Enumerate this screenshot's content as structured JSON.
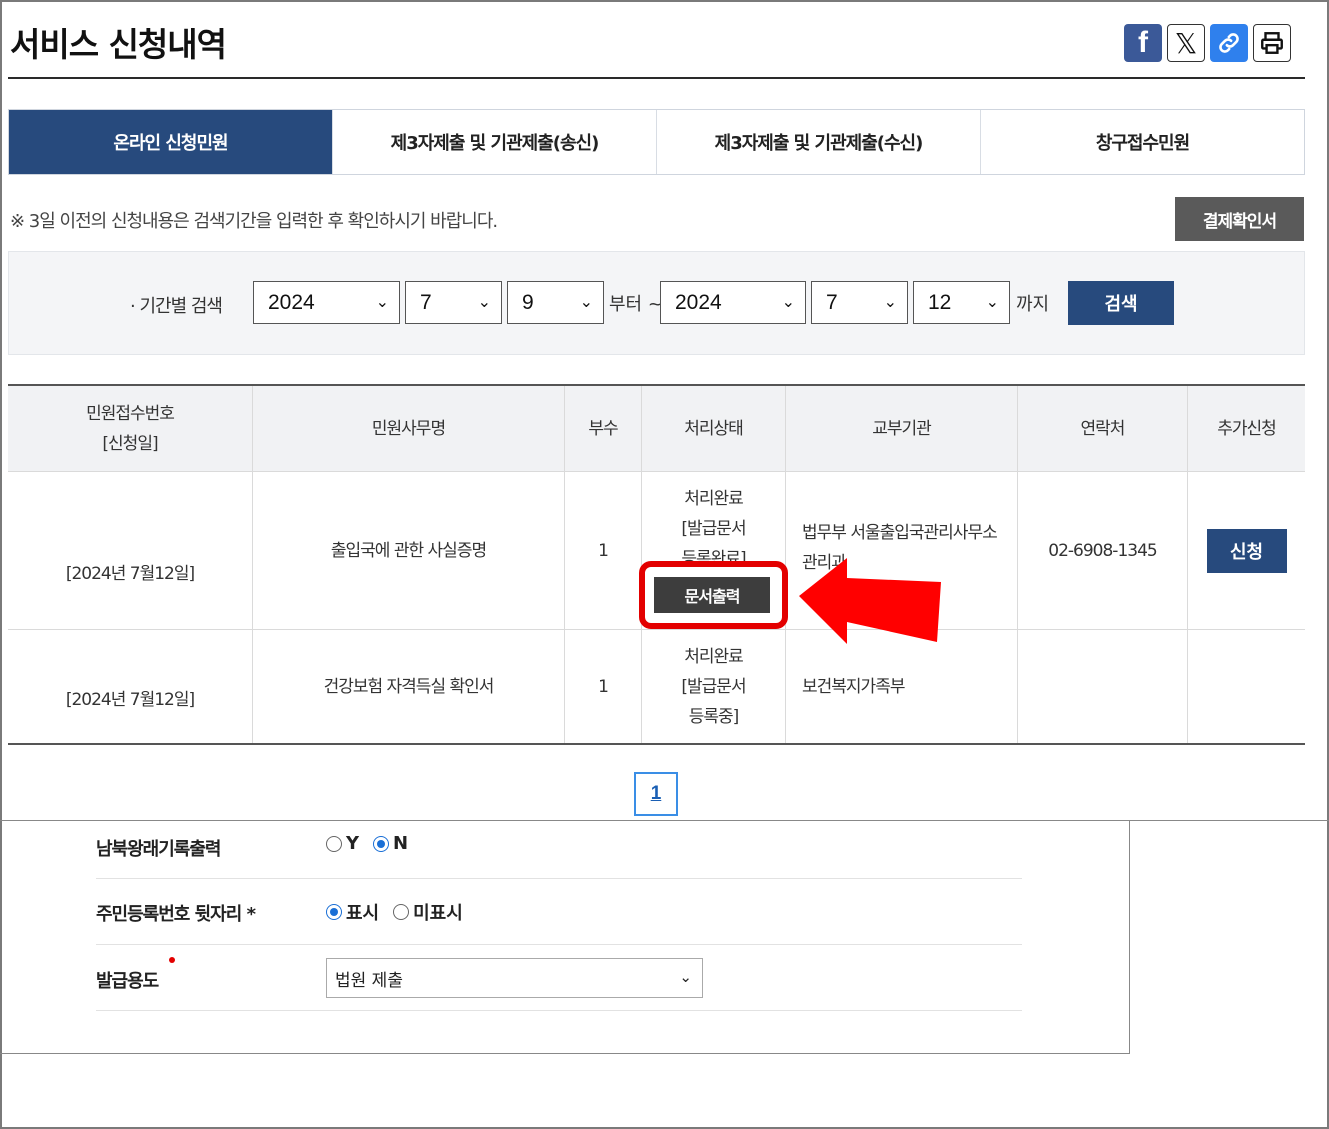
{
  "page": {
    "title": "서비스 신청내역"
  },
  "share": {
    "facebook": "f",
    "x": "𝕏"
  },
  "tabs": [
    {
      "label": "온라인 신청민원",
      "active": true
    },
    {
      "label": "제3자제출 및 기관제출(송신)",
      "active": false
    },
    {
      "label": "제3자제출 및 기관제출(수신)",
      "active": false
    },
    {
      "label": "창구접수민원",
      "active": false
    }
  ],
  "notice": "※ 3일 이전의 신청내용은 검색기간을 입력한 후 확인하시기 바랍니다.",
  "receipt_button": "결제확인서",
  "search": {
    "label": "· 기간별 검색",
    "from": {
      "year": "2024",
      "month": "7",
      "day": "9"
    },
    "from_text": "부터 ~",
    "to": {
      "year": "2024",
      "month": "7",
      "day": "12"
    },
    "to_text": "까지",
    "button": "검색"
  },
  "table": {
    "headers": [
      "민원접수번호",
      "[신청일]",
      "민원사무명",
      "부수",
      "처리상태",
      "교부기관",
      "연락처",
      "추가신청"
    ],
    "rows": [
      {
        "date": "[2024년 7월12일]",
        "name": "출입국에 관한 사실증명",
        "copies": "1",
        "status": [
          "처리완료",
          "[발급문서",
          "등록완료]"
        ],
        "agency": [
          "법무부 서울출입국관리사무소",
          "관리과"
        ],
        "contact": "02-6908-1345",
        "apply": "신청",
        "print": "문서출력"
      },
      {
        "date": "[2024년 7월12일]",
        "name": "건강보험 자격득실 확인서",
        "copies": "1",
        "status": [
          "처리완료",
          "[발급문서",
          "등록중]"
        ],
        "agency": [
          "보건복지가족부"
        ],
        "contact": "",
        "apply": ""
      }
    ]
  },
  "pagination": {
    "current": "1"
  },
  "form": {
    "north_south": {
      "label": "남북왕래기록출력",
      "options": [
        "Y",
        "N"
      ],
      "selected": "N"
    },
    "rrn_back": {
      "label": "주민등록번호 뒷자리 *",
      "options": [
        "표시",
        "미표시"
      ],
      "selected": "표시"
    },
    "purpose": {
      "label": "발급용도",
      "value": "법원 제출"
    }
  },
  "colors": {
    "primary": "#274a7d",
    "highlight": "#e30000",
    "dark_button": "#3d3d3d"
  }
}
